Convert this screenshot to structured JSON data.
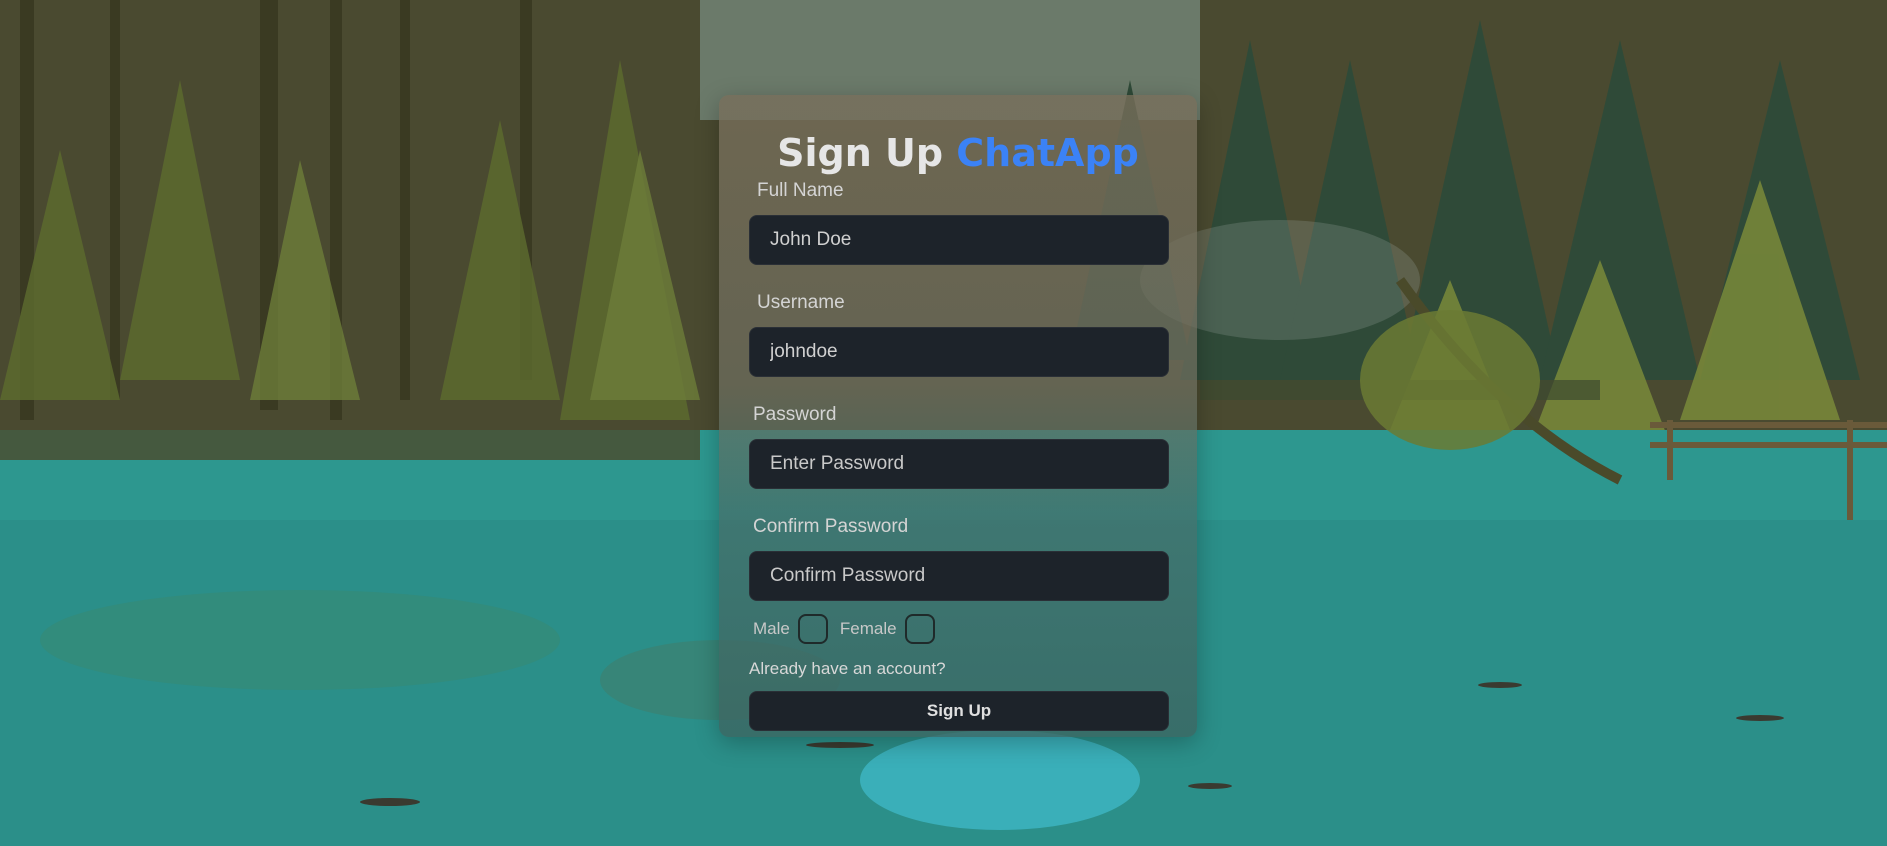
{
  "form": {
    "title": "Sign Up",
    "title_accent": "ChatApp",
    "fullname_label": "Full Name",
    "fullname_value": "John Doe",
    "username_label": "Username",
    "username_value": "johndoe",
    "password_label": "Password",
    "password_placeholder": "Enter Password",
    "confirm_label": "Confirm Password",
    "confirm_placeholder": "Confirm Password",
    "gender_male": "Male",
    "gender_female": "Female",
    "login_link": "Already have an account?",
    "submit_label": "Sign Up"
  },
  "colors": {
    "accent": "#3b82f6",
    "input_bg": "#1d232a"
  },
  "background": {
    "description_icon": "forest-lake-photo"
  }
}
